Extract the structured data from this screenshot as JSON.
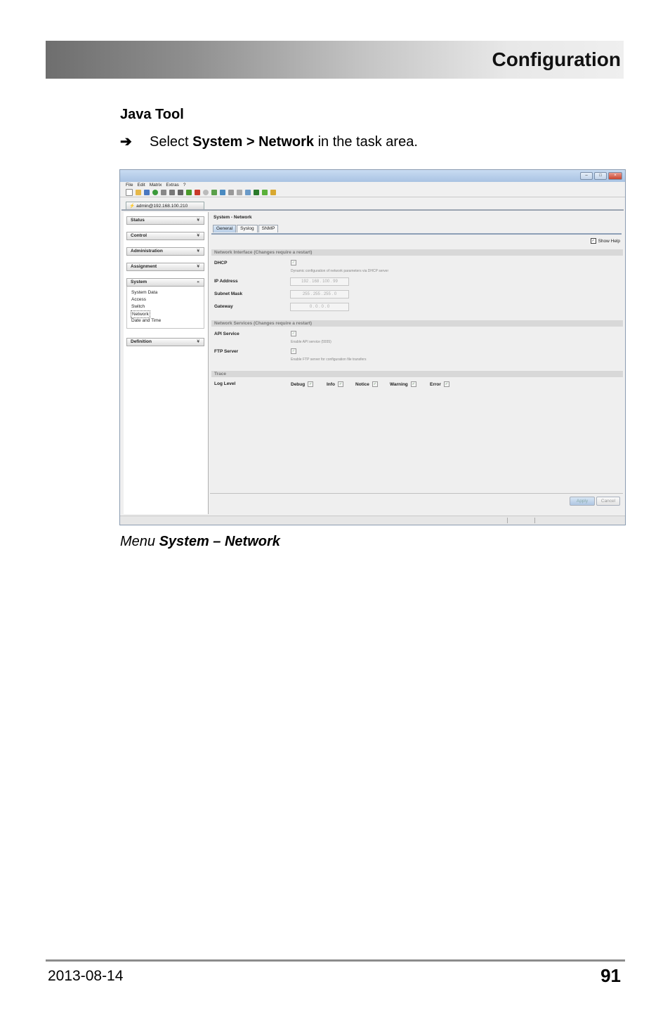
{
  "header": {
    "title": "Configuration"
  },
  "section": {
    "title": "Java Tool"
  },
  "instruction": {
    "arrow": "➔",
    "pre": "Select ",
    "bold": "System > Network",
    "post": " in the task area."
  },
  "screenshot": {
    "menu": [
      "File",
      "Edit",
      "Matrix",
      "Extras",
      "?"
    ],
    "connection_tab": "admin@192.168.100.210",
    "sidebar": {
      "status": "Status",
      "control": "Control",
      "administration": "Administration",
      "assignment": "Assignment",
      "system": "System",
      "system_items": [
        "System Data",
        "Access",
        "Switch",
        "Network",
        "Date and Time"
      ],
      "definition": "Definition",
      "chev_down": "¥",
      "chev_up": "«"
    },
    "main": {
      "title": "System - Network",
      "tabs": [
        "General",
        "Syslog",
        "SNMP"
      ],
      "show_help": "Show Help",
      "net_interface_header": "Network Interface (Changes require a restart)",
      "dhcp_label": "DHCP",
      "dhcp_help": "Dynamic configuration of network parameters via DHCP server",
      "ip_label": "IP Address",
      "ip_value": "192 . 168 . 100 . 99",
      "subnet_label": "Subnet Mask",
      "subnet_value": "255 . 255 . 255 . 0",
      "gateway_label": "Gateway",
      "gateway_value": "0 . 0 . 0 . 0",
      "net_services_header": "Network Services (Changes require a restart)",
      "api_label": "API Service",
      "api_help": "Enable API service (5555)",
      "ftp_label": "FTP Server",
      "ftp_help": "Enable FTP server for configuration file transfers",
      "trace_header": "Trace",
      "log_label": "Log Level",
      "log_levels": [
        "Debug",
        "Info",
        "Notice",
        "Warning",
        "Error"
      ],
      "apply": "Apply",
      "cancel": "Cancel"
    }
  },
  "caption": {
    "pre": "Menu ",
    "bold": "System – Network"
  },
  "footer": {
    "date": "2013-08-14",
    "page": "91"
  }
}
